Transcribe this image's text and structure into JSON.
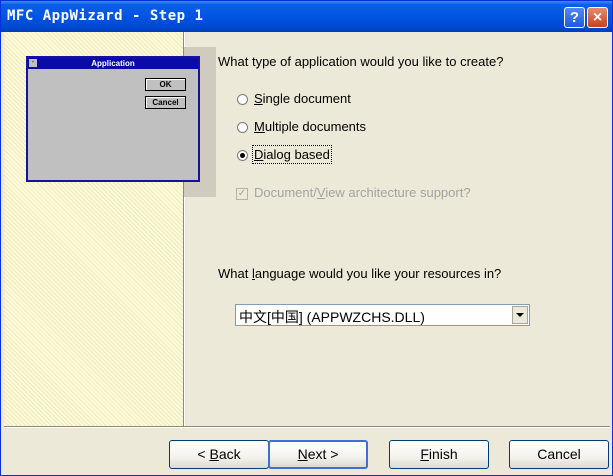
{
  "window": {
    "title": "MFC AppWizard - Step 1",
    "help_label": "?",
    "close_label": "×"
  },
  "preview": {
    "title": "Application",
    "ok_label": "OK",
    "cancel_label": "Cancel",
    "sys_glyph": "-"
  },
  "question1": {
    "label": "What type of application would you like to create?"
  },
  "app_types": [
    {
      "label": "Single document",
      "mnemonic": "S",
      "rest": "ingle document",
      "selected": false
    },
    {
      "label": "Multiple documents",
      "mnemonic": "M",
      "rest": "ultiple documents",
      "selected": false
    },
    {
      "label": "Dialog based",
      "mnemonic": "D",
      "rest": "ialog based",
      "selected": true
    }
  ],
  "docview": {
    "pre": "Document/",
    "mnemonic": "V",
    "post": "iew architecture support?",
    "checked": true,
    "enabled": false
  },
  "question2": {
    "pre": "What ",
    "mnemonic": "l",
    "post": "anguage would you like your resources in?"
  },
  "language": {
    "value": "中文[中国] (APPWZCHS.DLL)"
  },
  "buttons": {
    "back": {
      "pre": "< ",
      "mnemonic": "B",
      "post": "ack"
    },
    "next": {
      "mnemonic": "N",
      "post": "ext >"
    },
    "finish": {
      "mnemonic": "F",
      "post": "inish"
    },
    "cancel": {
      "label": "Cancel"
    }
  },
  "colors": {
    "titlebar": "#0054E3",
    "dialog_bg": "#ECE9D8",
    "left_pane": "#FFFAD7",
    "preview_title": "#0A0AA8"
  }
}
